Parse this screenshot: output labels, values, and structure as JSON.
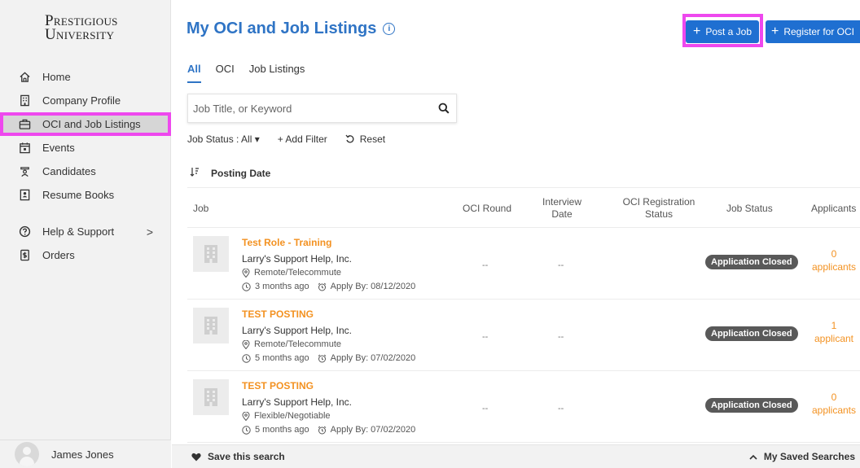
{
  "logo": {
    "line1": "Prestigious",
    "line2": "University"
  },
  "sidebar": {
    "items": [
      {
        "label": "Home",
        "icon": "home-icon"
      },
      {
        "label": "Company Profile",
        "icon": "building-icon"
      },
      {
        "label": "OCI and Job Listings",
        "icon": "briefcase-icon",
        "active": true
      },
      {
        "label": "Events",
        "icon": "calendar-icon"
      },
      {
        "label": "Candidates",
        "icon": "candidates-icon"
      },
      {
        "label": "Resume Books",
        "icon": "resume-book-icon"
      },
      {
        "label": "Help & Support",
        "icon": "help-icon",
        "chevron": ">"
      },
      {
        "label": "Orders",
        "icon": "orders-icon"
      }
    ],
    "user": "James Jones"
  },
  "header": {
    "title": "My OCI and Job Listings",
    "post_job": "Post a Job",
    "register_oci": "Register for OCI"
  },
  "tabs": [
    "All",
    "OCI",
    "Job Listings"
  ],
  "search": {
    "placeholder": "Job Title, or Keyword"
  },
  "filters": {
    "job_status": "Job Status : All ▾",
    "add_filter": "+ Add Filter",
    "reset": "Reset"
  },
  "sort": {
    "label": "Posting Date"
  },
  "table": {
    "headers": {
      "job": "Job",
      "oci_round": "OCI Round",
      "interview_date_1": "Interview",
      "interview_date_2": "Date",
      "oci_reg_1": "OCI Registration",
      "oci_reg_2": "Status",
      "job_status": "Job Status",
      "applicants": "Applicants"
    },
    "rows": [
      {
        "title": "Test Role - Training",
        "company": "Larry's Support Help, Inc.",
        "location": "Remote/Telecommute",
        "posted": "3 months ago",
        "apply_by": "Apply By: 08/12/2020",
        "oci_round": "--",
        "interview_date": "--",
        "status": "Application Closed",
        "applicants_count": "0",
        "applicants_label": "applicants"
      },
      {
        "title": "TEST POSTING",
        "company": "Larry's Support Help, Inc.",
        "location": "Remote/Telecommute",
        "posted": "5 months ago",
        "apply_by": "Apply By: 07/02/2020",
        "oci_round": "--",
        "interview_date": "--",
        "status": "Application Closed",
        "applicants_count": "1",
        "applicants_label": "applicant"
      },
      {
        "title": "TEST POSTING",
        "company": "Larry's Support Help, Inc.",
        "location": "Flexible/Negotiable",
        "posted": "5 months ago",
        "apply_by": "Apply By: 07/02/2020",
        "oci_round": "--",
        "interview_date": "--",
        "status": "Application Closed",
        "applicants_count": "0",
        "applicants_label": "applicants"
      }
    ]
  },
  "footer": {
    "save_search": "Save this search",
    "saved_searches": "My Saved Searches"
  },
  "colors": {
    "accent": "#2f74c5",
    "button": "#1f6fd1",
    "orange": "#f39222",
    "highlight": "#ee48ee"
  }
}
